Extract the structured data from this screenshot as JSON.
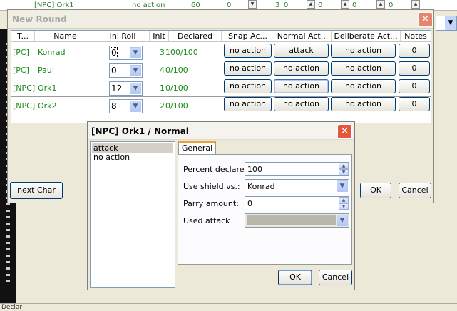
{
  "background": {
    "strip_cells": [
      "[NPC] Ork1",
      "no action",
      "60",
      "0",
      "3",
      "0",
      "0",
      "0",
      "0"
    ],
    "bottom_text": "Declar"
  },
  "main_window": {
    "title": "New Round",
    "columns": [
      "T...",
      "Name",
      "Ini Roll",
      "Init",
      "Declared",
      "Snap Ac...",
      "Normal Act...",
      "Deliberate Act...",
      "Notes"
    ],
    "rows": [
      {
        "type": "[PC]",
        "name": "Konrad",
        "ini_roll": "0",
        "init": "3",
        "declared": "100/100",
        "snap": "no action",
        "normal": "attack",
        "deliberate": "no action",
        "notes": "0"
      },
      {
        "type": "[PC]",
        "name": "Paul",
        "ini_roll": "0",
        "init": "4",
        "declared": "0/100",
        "snap": "no action",
        "normal": "no action",
        "deliberate": "no action",
        "notes": "0"
      },
      {
        "type": "[NPC]",
        "name": "Ork1",
        "ini_roll": "12",
        "init": "1",
        "declared": "0/100",
        "snap": "no action",
        "normal": "no action",
        "deliberate": "no action",
        "notes": "0"
      },
      {
        "type": "[NPC]",
        "name": "Ork2",
        "ini_roll": "8",
        "init": "2",
        "declared": "0/100",
        "snap": "no action",
        "normal": "no action",
        "deliberate": "no action",
        "notes": "0"
      }
    ],
    "next_char_label": "next Char",
    "ok_label": "OK",
    "cancel_label": "Cancel"
  },
  "action_dialog": {
    "title": "[NPC] Ork1 / Normal",
    "actions": [
      "attack",
      "no action"
    ],
    "selected_action": "attack",
    "tab_label": "General",
    "percent_label": "Percent declared:",
    "percent_value": "100",
    "shield_label": "Use shield vs.:",
    "shield_value": "Konrad",
    "parry_label": "Parry amount:",
    "parry_value": "0",
    "attack_label": "Used attack",
    "ok_label": "OK",
    "cancel_label": "Cancel"
  },
  "icons": {
    "close": "close-icon",
    "dropdown": "chevron-down-icon",
    "spin_up": "arrow-up-icon",
    "spin_down": "arrow-down-icon"
  },
  "colors": {
    "row_text": "#1a8a1a",
    "close_button": "#e4573d",
    "selection": "#d4d0c8",
    "tab_accent": "#e8a23a"
  }
}
